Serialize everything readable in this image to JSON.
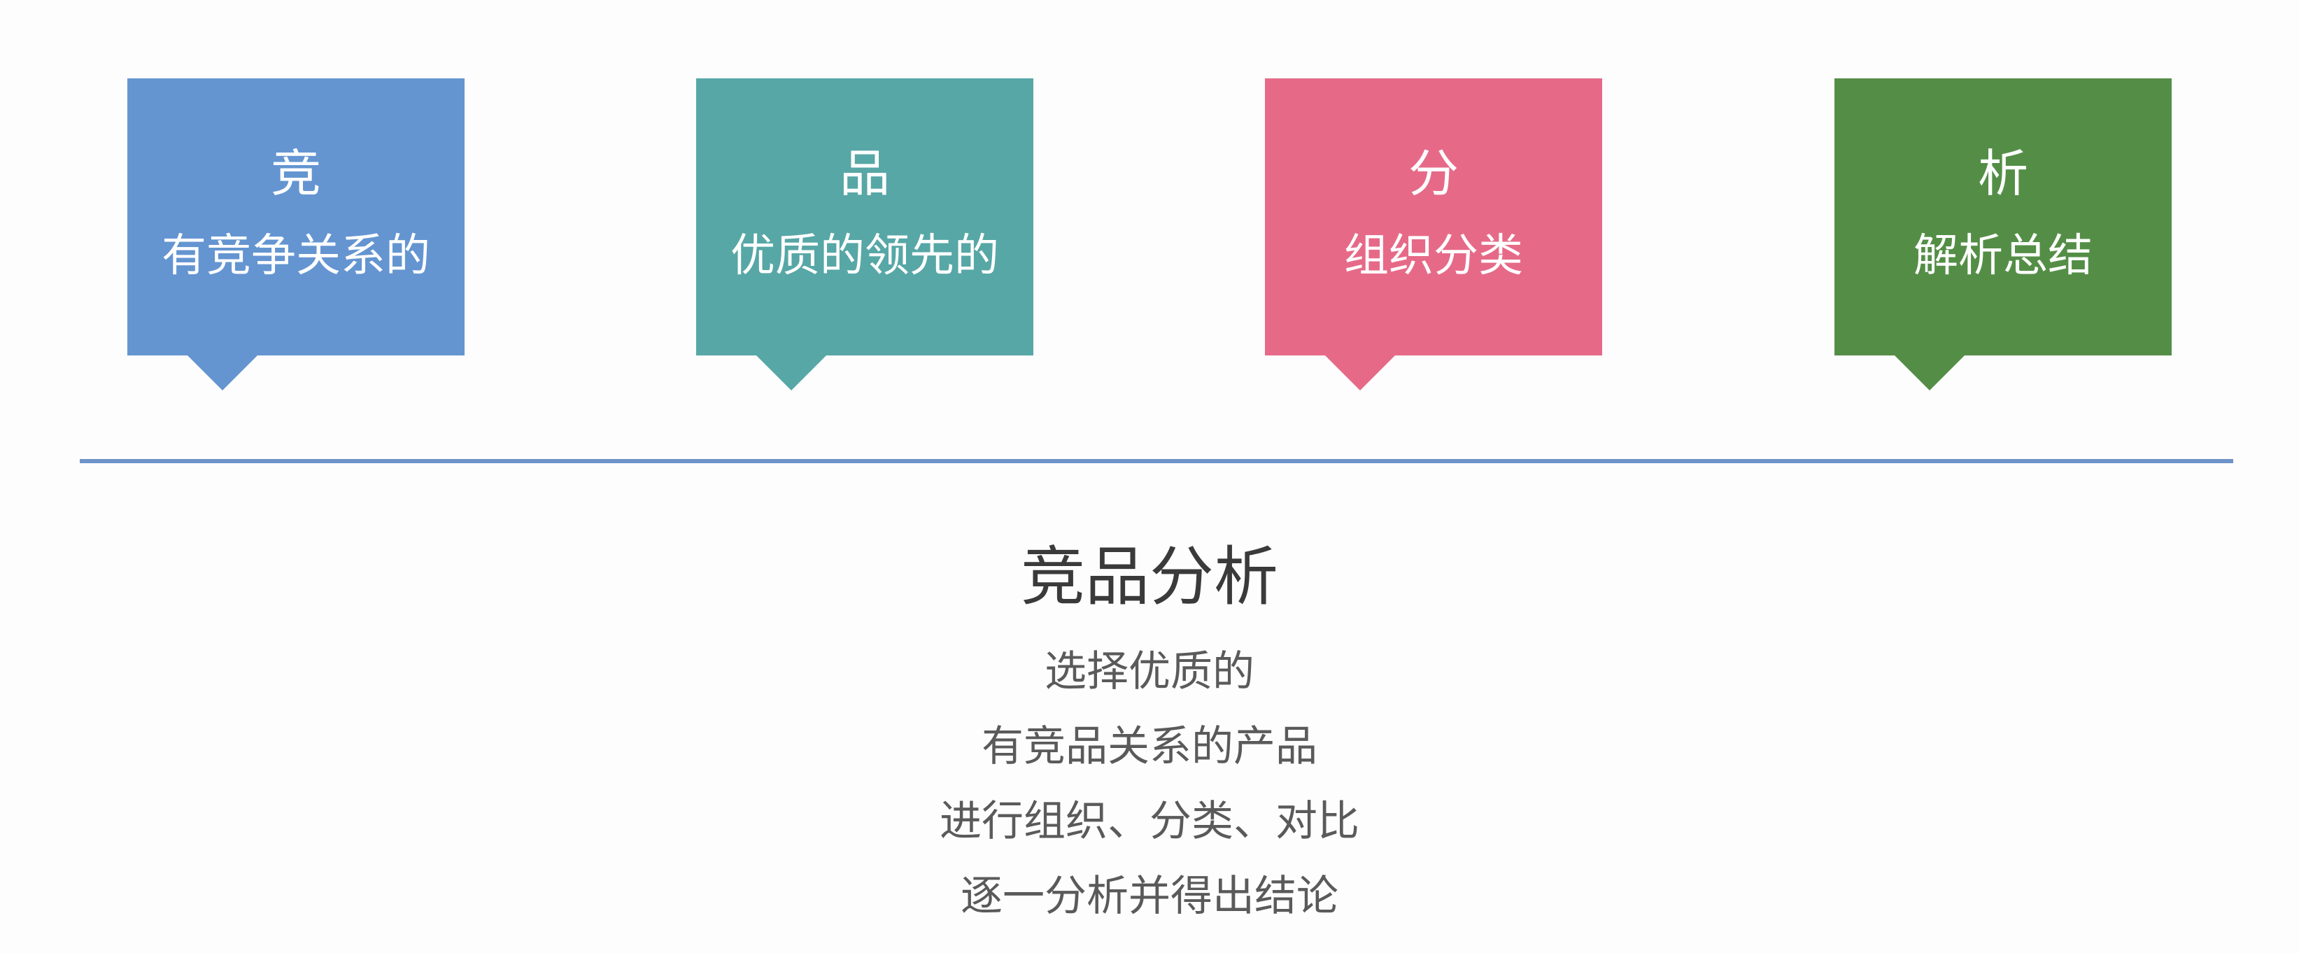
{
  "cards": [
    {
      "title": "竞",
      "subtitle": "有竞争关系的",
      "color": "#6495d1"
    },
    {
      "title": "品",
      "subtitle": "优质的领先的",
      "color": "#57a7a6"
    },
    {
      "title": "分",
      "subtitle": "组织分类",
      "color": "#e66a88"
    },
    {
      "title": "析",
      "subtitle": "解析总结",
      "color": "#548e46"
    }
  ],
  "divider_color": "#6f94c9",
  "main": {
    "title": "竞品分析",
    "lines": [
      "选择优质的",
      "有竞品关系的产品",
      "进行组织、分类、对比",
      "逐一分析并得出结论"
    ]
  }
}
